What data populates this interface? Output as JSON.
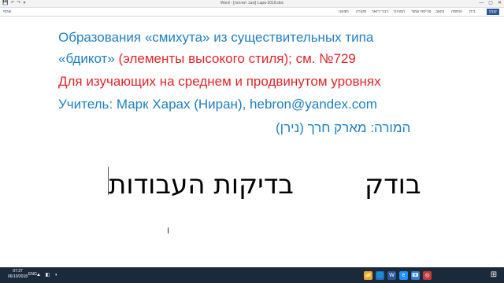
{
  "titlebar": {
    "title": "Word - [מצב תאימות] Lapa-2018.doc",
    "user": "",
    "quick_access": [
      "💾",
      "↶",
      "↷",
      "▾"
    ],
    "window_controls": [
      "—",
      "▢",
      "✕"
    ]
  },
  "ribbon": {
    "tabs": [
      "קובץ",
      "בית",
      "הוספה",
      "עיצוב",
      "פריסת עמוד",
      "הפניות",
      "דברי דואר",
      "סקירה",
      "תצוגה"
    ],
    "share": "שתף"
  },
  "document": {
    "line1": "Образования «смихута» из существительных типа",
    "line2_blue": "«бдикот»",
    "line2_red": " (элементы высокого стиля); см. №729",
    "line3": "Для изучающих на среднем и продвинутом уровнях",
    "line4": "Учитель: Марк Харах (Ниран),      hebron@yandex.com",
    "line5": "המורה: מארק חרך (נירן)",
    "big_left": "בדיקות העבודות",
    "big_right": "בודק"
  },
  "taskbar": {
    "start_icon": "windows-icon",
    "clock_time": "07:27",
    "clock_date": "06/10/2018",
    "lang": "ENG",
    "app_icons": [
      "📁",
      "🌐",
      "W",
      "e",
      "📧",
      "◎"
    ],
    "colors": {
      "taskbar_bg": "#1b2a3a",
      "word_blue": "#2b579a"
    }
  }
}
